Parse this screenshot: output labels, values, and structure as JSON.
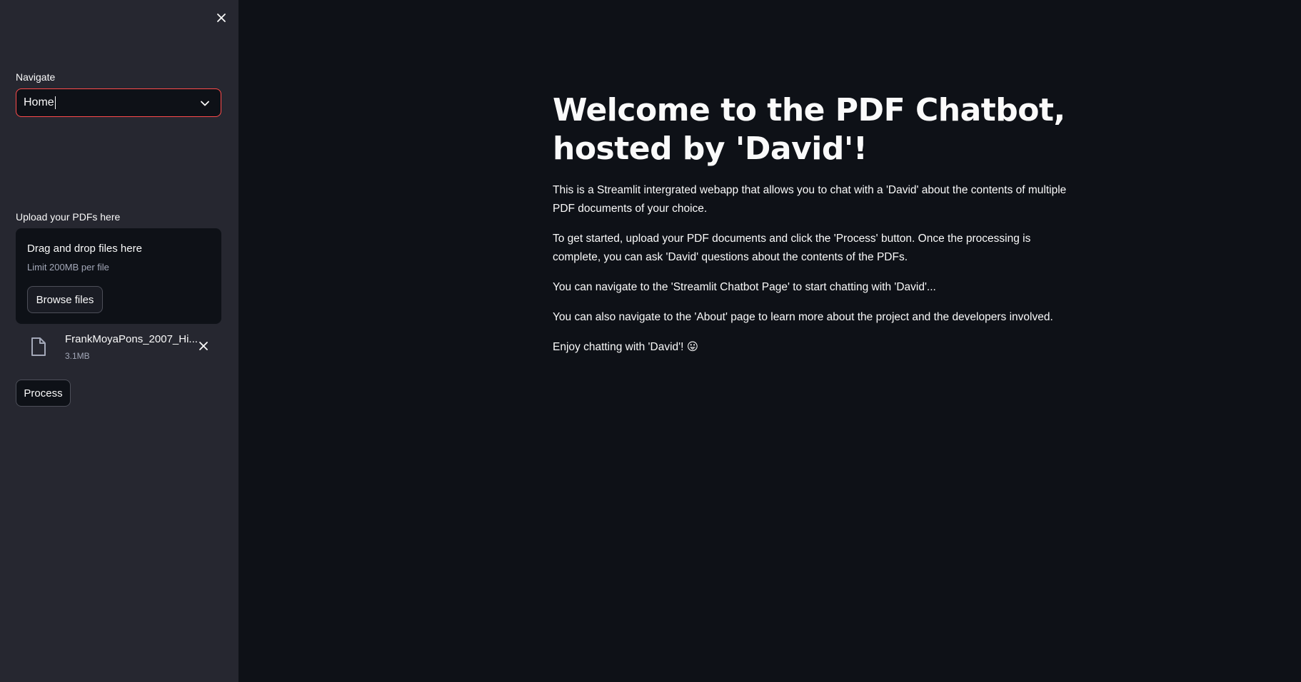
{
  "sidebar": {
    "navigate_label": "Navigate",
    "navigate_value": "Home",
    "upload_label": "Upload your PDFs here",
    "dropzone_title": "Drag and drop files here",
    "dropzone_limit": "Limit 200MB per file",
    "browse_label": "Browse files",
    "file": {
      "name": "FrankMoyaPons_2007_Hi...",
      "size": "3.1MB"
    },
    "process_label": "Process"
  },
  "main": {
    "title": "Welcome to the PDF Chatbot, hosted by 'David'!",
    "paragraphs": [
      "This is a Streamlit intergrated webapp that allows you to chat with a 'David' about the contents of multiple PDF documents of your choice.",
      "To get started, upload your PDF documents and click the 'Process' button. Once the processing is complete, you can ask 'David' questions about the contents of the PDFs.",
      "You can navigate to the 'Streamlit Chatbot Page' to start chatting with 'David'...",
      "You can also navigate to the 'About' page to learn more about the project and the developers involved.",
      "Enjoy chatting with 'David'! 😛"
    ]
  },
  "icons": {
    "close": "close-icon",
    "chevron": "chevron-down-icon",
    "file": "file-icon",
    "remove": "remove-file-icon"
  },
  "colors": {
    "background": "#0e1117",
    "sidebar": "#262730",
    "accent": "#ff4b4b",
    "text": "#fafafa",
    "muted": "#a3a8b8"
  }
}
